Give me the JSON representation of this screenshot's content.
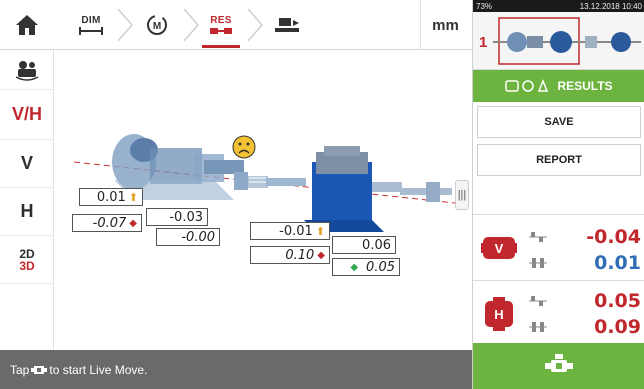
{
  "toolbar": {
    "steps": [
      {
        "label": "DIM"
      },
      {
        "label": ""
      },
      {
        "label": "RES"
      },
      {
        "label": ""
      }
    ],
    "units": "mm"
  },
  "left_tools": {
    "vh": "V/H",
    "v": "V",
    "h": "H",
    "two_d": "2D",
    "three_d": "3D"
  },
  "viewport": {
    "tolerance_icon": "sad-face-icon",
    "left_machine": {
      "top_left": "0.01",
      "top_right": "-0.03",
      "bottom_left": "-0.07",
      "bottom_right": "-0.00"
    },
    "right_machine": {
      "top_left": "-0.01",
      "top_right": "0.06",
      "bottom_left": "0.10",
      "bottom_right": "0.05"
    }
  },
  "status": {
    "prefix": "Tap",
    "suffix": "to start Live Move."
  },
  "right_panel": {
    "android_status": {
      "battery": "73%",
      "datetime": "13.12.2018 10:40"
    },
    "coupling_index": "1",
    "results_label": "RESULTS",
    "save_label": "SAVE",
    "report_label": "REPORT",
    "vertical": {
      "offset": "-0.04",
      "angularity": "0.01"
    },
    "horizontal": {
      "offset": "0.05",
      "angularity": "0.09"
    }
  },
  "colors": {
    "accent_red": "#c0282d",
    "accent_green": "#6cb33f",
    "value_blue": "#2f6eb5",
    "status_bar": "#6a6a6a"
  }
}
